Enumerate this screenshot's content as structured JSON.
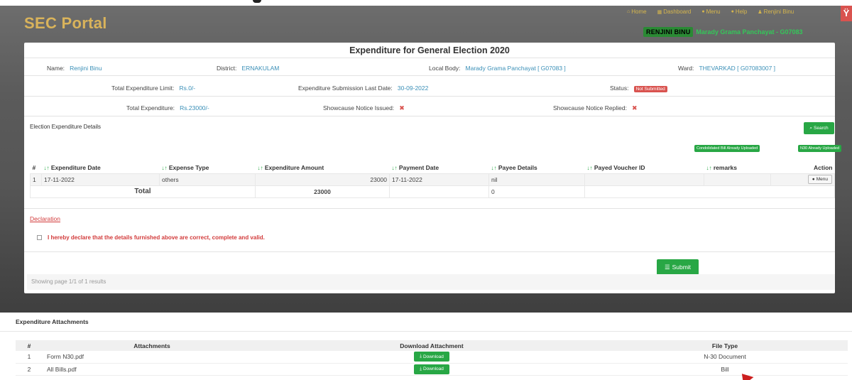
{
  "app": {
    "title": "SEC Portal"
  },
  "topnav": {
    "items": [
      {
        "icon": "home-icon",
        "glyph": "⌂",
        "label": "Home"
      },
      {
        "icon": "dashboard-icon",
        "glyph": "▦",
        "label": "Dashboard"
      },
      {
        "icon": "menu-icon",
        "glyph": "●",
        "label": "Menu"
      },
      {
        "icon": "help-icon",
        "glyph": "●",
        "label": "Help"
      },
      {
        "icon": "user-icon",
        "glyph": "♟",
        "label": "Renjini Binu"
      }
    ],
    "user_badge_glyph": "Ÿ"
  },
  "user_line": {
    "name": "RENJINI BINU",
    "local_body": "Marady Grama Panchayat - G07083"
  },
  "panel": {
    "title": "Expenditure for General Election 2020",
    "name_label": "Name:",
    "name_value": "Renjini Binu",
    "district_label": "District:",
    "district_value": "ERNAKULAM",
    "local_body_label": "Local Body:",
    "local_body_value": "Marady Grama Panchayat [ G07083 ]",
    "ward_label": "Ward:",
    "ward_value": "THEVARKAD [ G07083007 ]",
    "limit_label": "Total Expenditure Limit:",
    "limit_value": "Rs.0/-",
    "last_date_label": "Expenditure Submission Last Date:",
    "last_date_value": "30-09-2022",
    "status_label": "Status:",
    "status_value": "Not Submitted",
    "total_exp_label": "Total Expenditure:",
    "total_exp_value": "Rs.23000/-",
    "notice_issued_label": "Showcause Notice Issued:",
    "notice_issued_value": "✖",
    "notice_replied_label": "Showcause Notice Replied:",
    "notice_replied_value": "✖",
    "section_label": "Election Expenditure Details",
    "search_label": "Search",
    "search_glyph": "⌕",
    "pill_bill": "Condolidated Bill Already Uploaded",
    "pill_n30": "N30 Already Uploaded"
  },
  "table": {
    "sort_glyph": "↓↑",
    "headers": [
      "#",
      "Expenditure Date",
      "Expense Type",
      "Expenditure Amount",
      "Payment Date",
      "Payee Details",
      "Payed Voucher ID",
      "remarks",
      "Action"
    ],
    "rows": [
      {
        "num": "1",
        "date": "17-11-2022",
        "type": "others",
        "amount": "23000",
        "pay_date": "17-11-2022",
        "payee": "nil",
        "voucher": "",
        "remarks": "",
        "action": "Menu",
        "action_glyph": "●"
      }
    ],
    "total_label": "Total",
    "total_amount": "23000",
    "total_payee": "0"
  },
  "declaration": {
    "title": "Declaration",
    "text": "I hereby declare that the details furnished above are correct, complete and valid."
  },
  "submit": {
    "label": "Submit",
    "glyph": "☰"
  },
  "pager": {
    "text": "Showing page 1/1 of 1 results"
  },
  "attachments": {
    "title": "Expenditure Attachments",
    "headers": [
      "#",
      "Attachments",
      "Download Attachment",
      "File Type"
    ],
    "download_glyph": "⤓",
    "rows": [
      {
        "num": "1",
        "name": "Form N30.pdf",
        "download": "Download",
        "type": "N-30 Document"
      },
      {
        "num": "2",
        "name": "All Bills.pdf",
        "download": "Download",
        "type": "Bill"
      }
    ]
  }
}
